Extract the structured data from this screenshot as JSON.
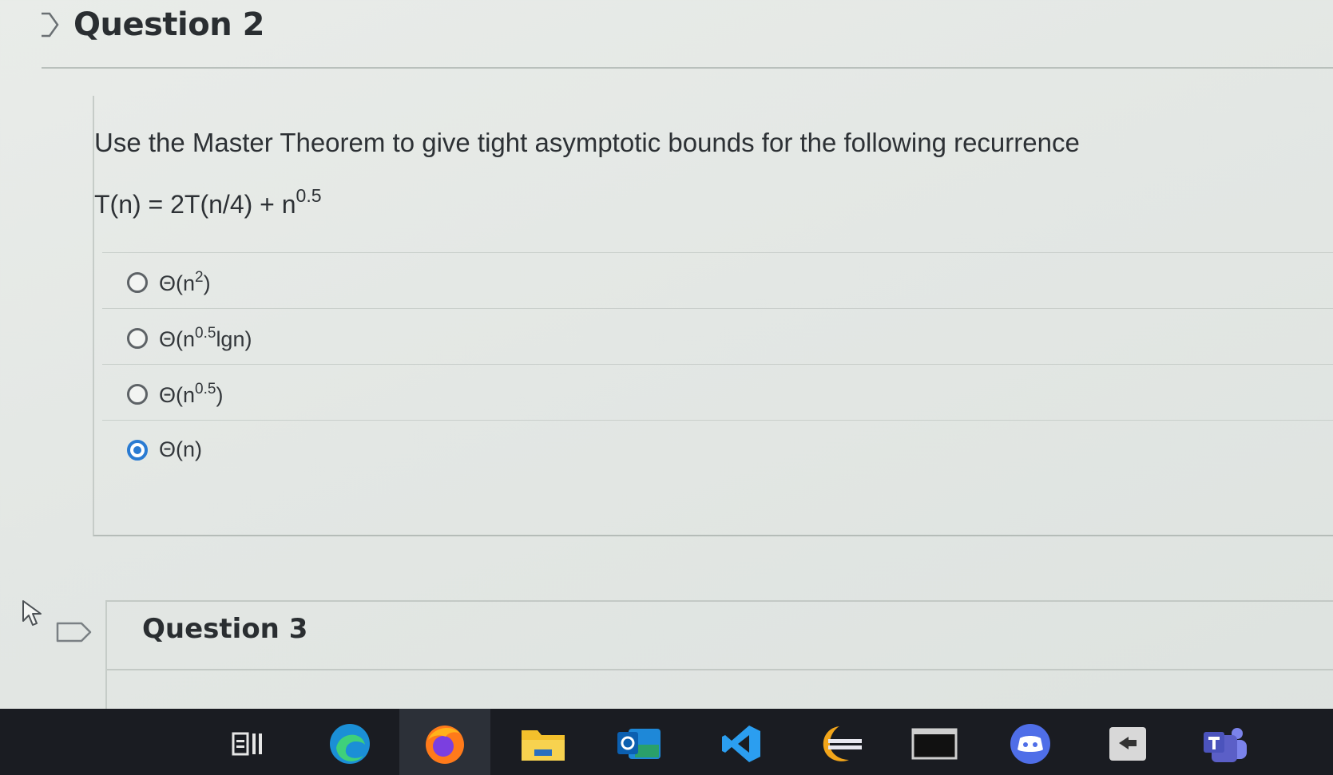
{
  "question2": {
    "title": "Question 2",
    "prompt": "Use the Master Theorem to give tight asymptotic bounds for the following recurrence",
    "formula_base": "T(n) = 2T(n/4) + n",
    "formula_exp": "0.5",
    "options": [
      {
        "pre": "Θ(n",
        "sup": "2",
        "post": ")",
        "selected": false
      },
      {
        "pre": "Θ(n",
        "sup": "0.5",
        "post": "lgn)",
        "selected": false
      },
      {
        "pre": "Θ(n",
        "sup": "0.5",
        "post": ")",
        "selected": false
      },
      {
        "pre": "Θ(n)",
        "sup": "",
        "post": "",
        "selected": true
      }
    ],
    "selected_index": 3
  },
  "question3": {
    "title": "Question 3"
  },
  "taskbar": {
    "icons": [
      "task-view-icon",
      "edge-icon",
      "firefox-icon",
      "file-explorer-icon",
      "outlook-icon",
      "vscode-icon",
      "eclipse-icon",
      "terminal-icon",
      "discord-icon",
      "app-icon",
      "teams-icon"
    ],
    "active": "firefox-icon"
  },
  "colors": {
    "accent": "#2a7bd2",
    "taskbar": "#1a1c22"
  }
}
